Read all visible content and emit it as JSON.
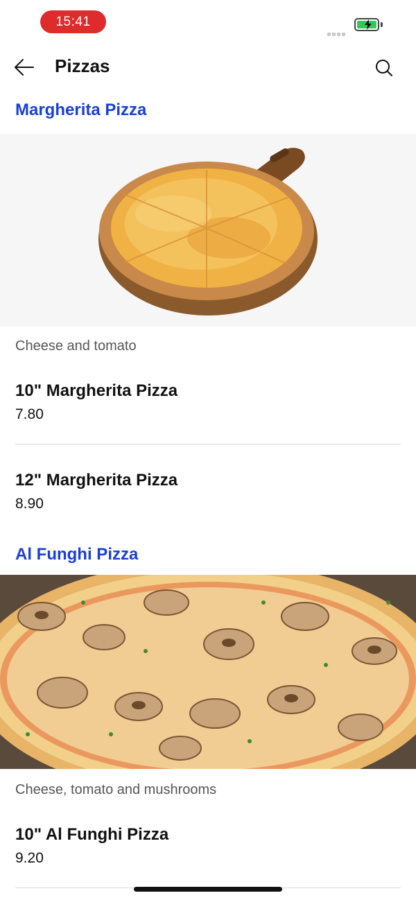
{
  "status": {
    "time": "15:41"
  },
  "header": {
    "title": "Pizzas"
  },
  "sections": [
    {
      "title": "Margherita Pizza",
      "description": "Cheese and tomato",
      "items": [
        {
          "name": "10\" Margherita Pizza",
          "price": "7.80"
        },
        {
          "name": "12\" Margherita Pizza",
          "price": "8.90"
        }
      ]
    },
    {
      "title": "Al Funghi Pizza",
      "description": "Cheese, tomato and mushrooms",
      "items": [
        {
          "name": "10\" Al Funghi Pizza",
          "price": "9.20"
        }
      ]
    }
  ],
  "colors": {
    "accent": "#1a3fd1",
    "time_pill": "#de2b2b",
    "battery": "#34c759"
  }
}
